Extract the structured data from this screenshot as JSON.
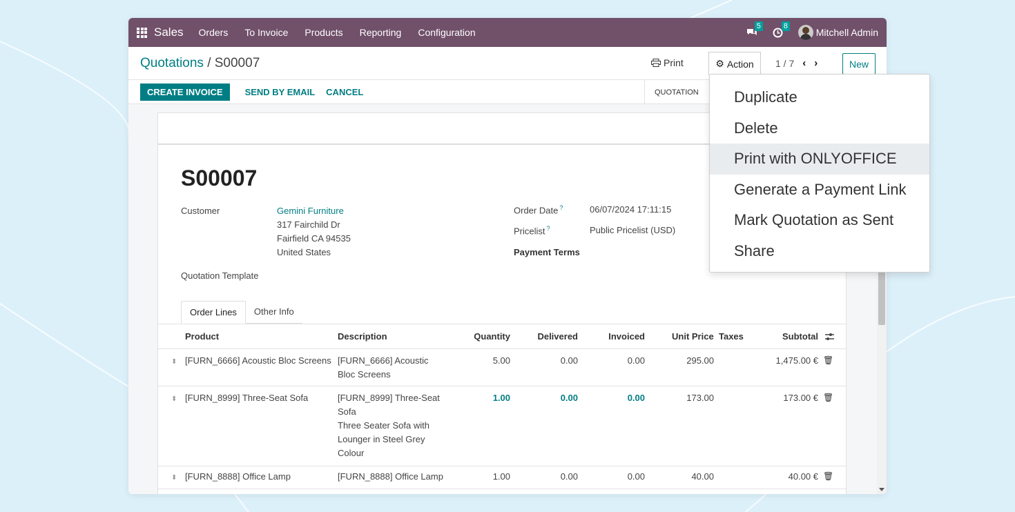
{
  "nav": {
    "app_name": "Sales",
    "menu": [
      "Orders",
      "To Invoice",
      "Products",
      "Reporting",
      "Configuration"
    ],
    "messages_count": "5",
    "activities_count": "8",
    "user": "Mitchell Admin"
  },
  "control": {
    "breadcrumb_parent": "Quotations",
    "breadcrumb_sep": "/",
    "breadcrumb_current": "S00007",
    "print_label": "Print",
    "action_label": "Action",
    "pager": "1 / 7",
    "new_label": "New"
  },
  "statusbar": {
    "create_invoice": "CREATE INVOICE",
    "send_email": "SEND BY EMAIL",
    "cancel": "CANCEL",
    "stage": "QUOTATION"
  },
  "form": {
    "name": "S00007",
    "customer_label": "Customer",
    "customer_name": "Gemini Furniture",
    "address1": "317 Fairchild Dr",
    "address2": "Fairfield CA 94535",
    "address3": "United States",
    "template_label": "Quotation Template",
    "order_date_label": "Order Date",
    "order_date": "06/07/2024 17:11:15",
    "pricelist_label": "Pricelist",
    "pricelist": "Public Pricelist (USD)",
    "payment_terms_label": "Payment Terms",
    "help_mark": "?"
  },
  "tabs": [
    "Order Lines",
    "Other Info"
  ],
  "table": {
    "headers": {
      "product": "Product",
      "description": "Description",
      "quantity": "Quantity",
      "delivered": "Delivered",
      "invoiced": "Invoiced",
      "unit_price": "Unit Price",
      "taxes": "Taxes",
      "subtotal": "Subtotal"
    },
    "rows": [
      {
        "product": "[FURN_6666] Acoustic Bloc Screens",
        "description": [
          "[FURN_6666] Acoustic",
          "Bloc Screens"
        ],
        "quantity": "5.00",
        "delivered": "0.00",
        "invoiced": "0.00",
        "unit_price": "295.00",
        "subtotal": "1,475.00 €"
      },
      {
        "product": "[FURN_8999] Three-Seat Sofa",
        "description": [
          "[FURN_8999] Three-Seat",
          "Sofa",
          "Three Seater Sofa with",
          "Lounger in Steel Grey",
          "Colour"
        ],
        "quantity": "1.00",
        "delivered": "0.00",
        "invoiced": "0.00",
        "unit_price": "173.00",
        "subtotal": "173.00 €"
      },
      {
        "product": "[FURN_8888] Office Lamp",
        "description": [
          "[FURN_8888] Office Lamp"
        ],
        "quantity": "1.00",
        "delivered": "0.00",
        "invoiced": "0.00",
        "unit_price": "40.00",
        "subtotal": "40.00 €"
      }
    ]
  },
  "action_menu": [
    "Duplicate",
    "Delete",
    "Print with ONLYOFFICE",
    "Generate a Payment Link",
    "Mark Quotation as Sent",
    "Share"
  ],
  "colors": {
    "navbar": "#71506a",
    "accent": "#017e84",
    "badge": "#00a09d"
  }
}
